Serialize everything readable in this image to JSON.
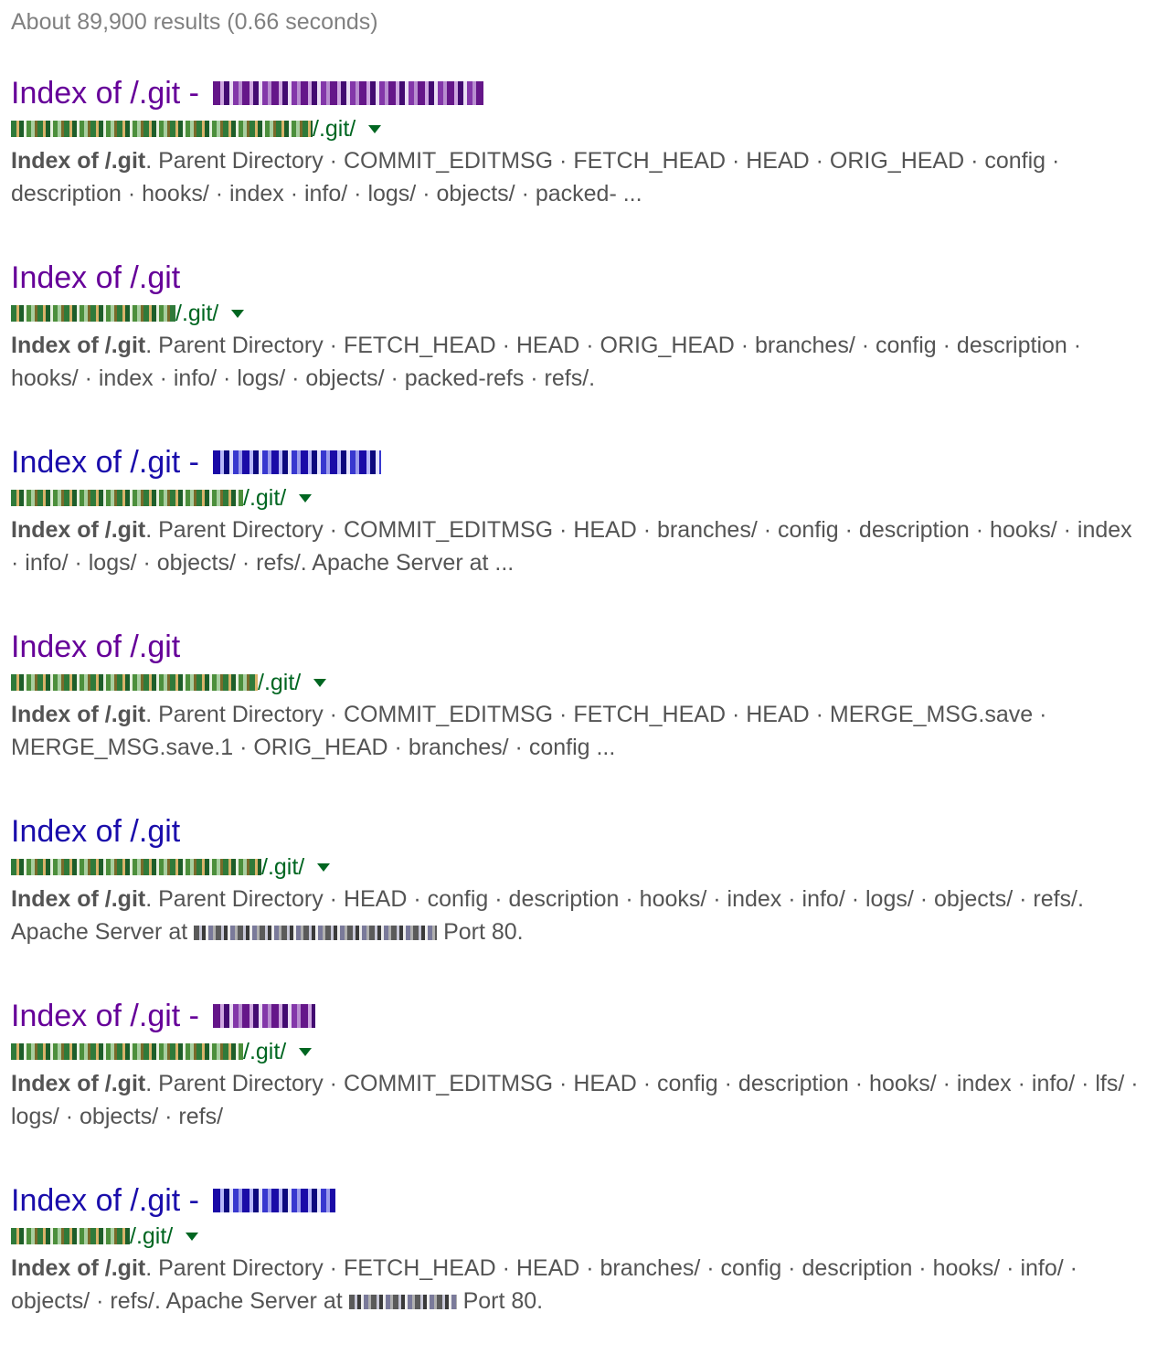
{
  "search": {
    "stats": "About 89,900 results (0.66 seconds)"
  },
  "results": [
    {
      "title": "Index of /.git - ",
      "title_redacted": true,
      "visited": true,
      "url_suffix": "/.git/",
      "snippet_bold": "Index of /.git",
      "snippet_text": ". Parent Directory · COMMIT_EDITMSG · FETCH_HEAD · HEAD · ORIG_HEAD · config · description · hooks/ · index · info/ · logs/ · objects/ · packed- ...",
      "snippet_tail": ""
    },
    {
      "title": "Index of /.git",
      "title_redacted": false,
      "visited": true,
      "url_suffix": "/.git/",
      "snippet_bold": "Index of /.git",
      "snippet_text": ". Parent Directory · FETCH_HEAD · HEAD · ORIG_HEAD · branches/ · config · description · hooks/ · index · info/ · logs/ · objects/ · packed-refs · refs/.",
      "snippet_tail": ""
    },
    {
      "title": "Index of /.git - ",
      "title_redacted": true,
      "visited": false,
      "url_suffix": "/.git/",
      "snippet_bold": "Index of /.git",
      "snippet_text": ". Parent Directory · COMMIT_EDITMSG · HEAD · branches/ · config · description · hooks/ · index · info/ · logs/ · objects/ · refs/. Apache Server at ...",
      "snippet_tail": ""
    },
    {
      "title": "Index of /.git",
      "title_redacted": false,
      "visited": true,
      "url_suffix": "/.git/",
      "snippet_bold": "Index of /.git",
      "snippet_text": ". Parent Directory · COMMIT_EDITMSG · FETCH_HEAD · HEAD · MERGE_MSG.save · MERGE_MSG.save.1 · ORIG_HEAD · branches/ · config ...",
      "snippet_tail": ""
    },
    {
      "title": "Index of /.git",
      "title_redacted": false,
      "visited": false,
      "url_suffix": "/.git/",
      "snippet_bold": "Index of /.git",
      "snippet_text": ". Parent Directory · HEAD · config · description · hooks/ · index · info/ · logs/ · objects/ · refs/. Apache Server at ",
      "snippet_tail": " Port 80."
    },
    {
      "title": "Index of /.git - ",
      "title_redacted": true,
      "visited": true,
      "url_suffix": "/.git/",
      "snippet_bold": "Index of /.git",
      "snippet_text": ". Parent Directory · COMMIT_EDITMSG · HEAD · config · description · hooks/ · index · info/ · lfs/ · logs/ · objects/ · refs/",
      "snippet_tail": ""
    },
    {
      "title": "Index of /.git - ",
      "title_redacted": true,
      "visited": false,
      "url_suffix": "/.git/",
      "snippet_bold": "Index of /.git",
      "snippet_text": ". Parent Directory · FETCH_HEAD · HEAD · branches/ · config · description · hooks/ · info/ · objects/ · refs/. Apache Server at ",
      "snippet_tail": " Port 80."
    }
  ],
  "colors": {
    "visited_link": "#660099",
    "unvisited_link": "#1a0dab",
    "url_green": "#006621",
    "snippet_gray": "#545454",
    "stats_gray": "#808080"
  },
  "icons": {
    "url_menu": "dropdown-arrow-icon"
  }
}
